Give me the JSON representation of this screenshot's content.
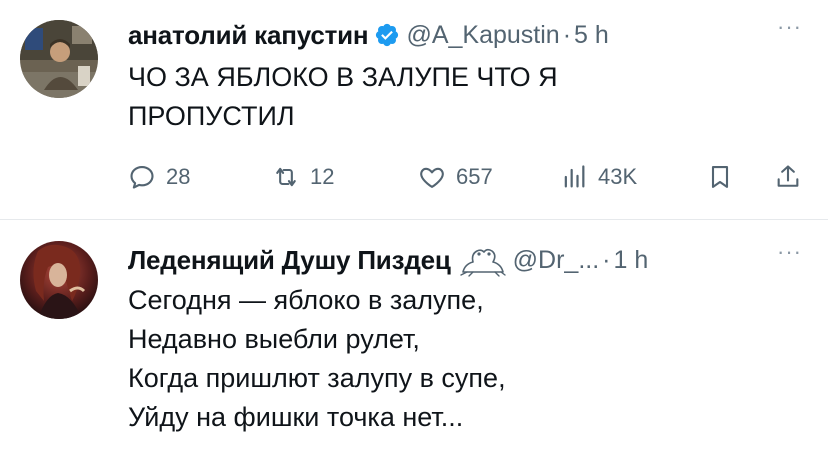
{
  "tweets": [
    {
      "author_name": "анатолий капустин",
      "verified": true,
      "handle": "@A_Kapustin",
      "dot": "·",
      "time": "5 h",
      "more": "···",
      "text_lines": [
        "ЧО ЗА ЯБЛОКО В ЗАЛУПЕ ЧТО Я",
        "ПРОПУСТИЛ"
      ],
      "stats": {
        "replies": "28",
        "retweets": "12",
        "likes": "657",
        "views": "43K"
      }
    },
    {
      "author_name": "Леденящий Душу Пиздец",
      "handle": "@Dr_...",
      "dot": "·",
      "time": "1 h",
      "more": "···",
      "text_lines": [
        "Сегодня — яблоко в залупе,",
        "Недавно выебли рулет,",
        "Когда пришлют залупу в супе,",
        "Уйду на фишки точка нет..."
      ]
    }
  ],
  "icons": {
    "reply": "reply-icon",
    "retweet": "retweet-icon",
    "like": "like-icon",
    "views": "views-icon",
    "bookmark": "bookmark-icon",
    "share": "share-icon",
    "verified": "verified-badge-icon",
    "frog": "frog-emoji-icon"
  },
  "colors": {
    "verified": "#1d9bf0",
    "secondary_text": "#536471",
    "divider": "#e6e9ec"
  }
}
